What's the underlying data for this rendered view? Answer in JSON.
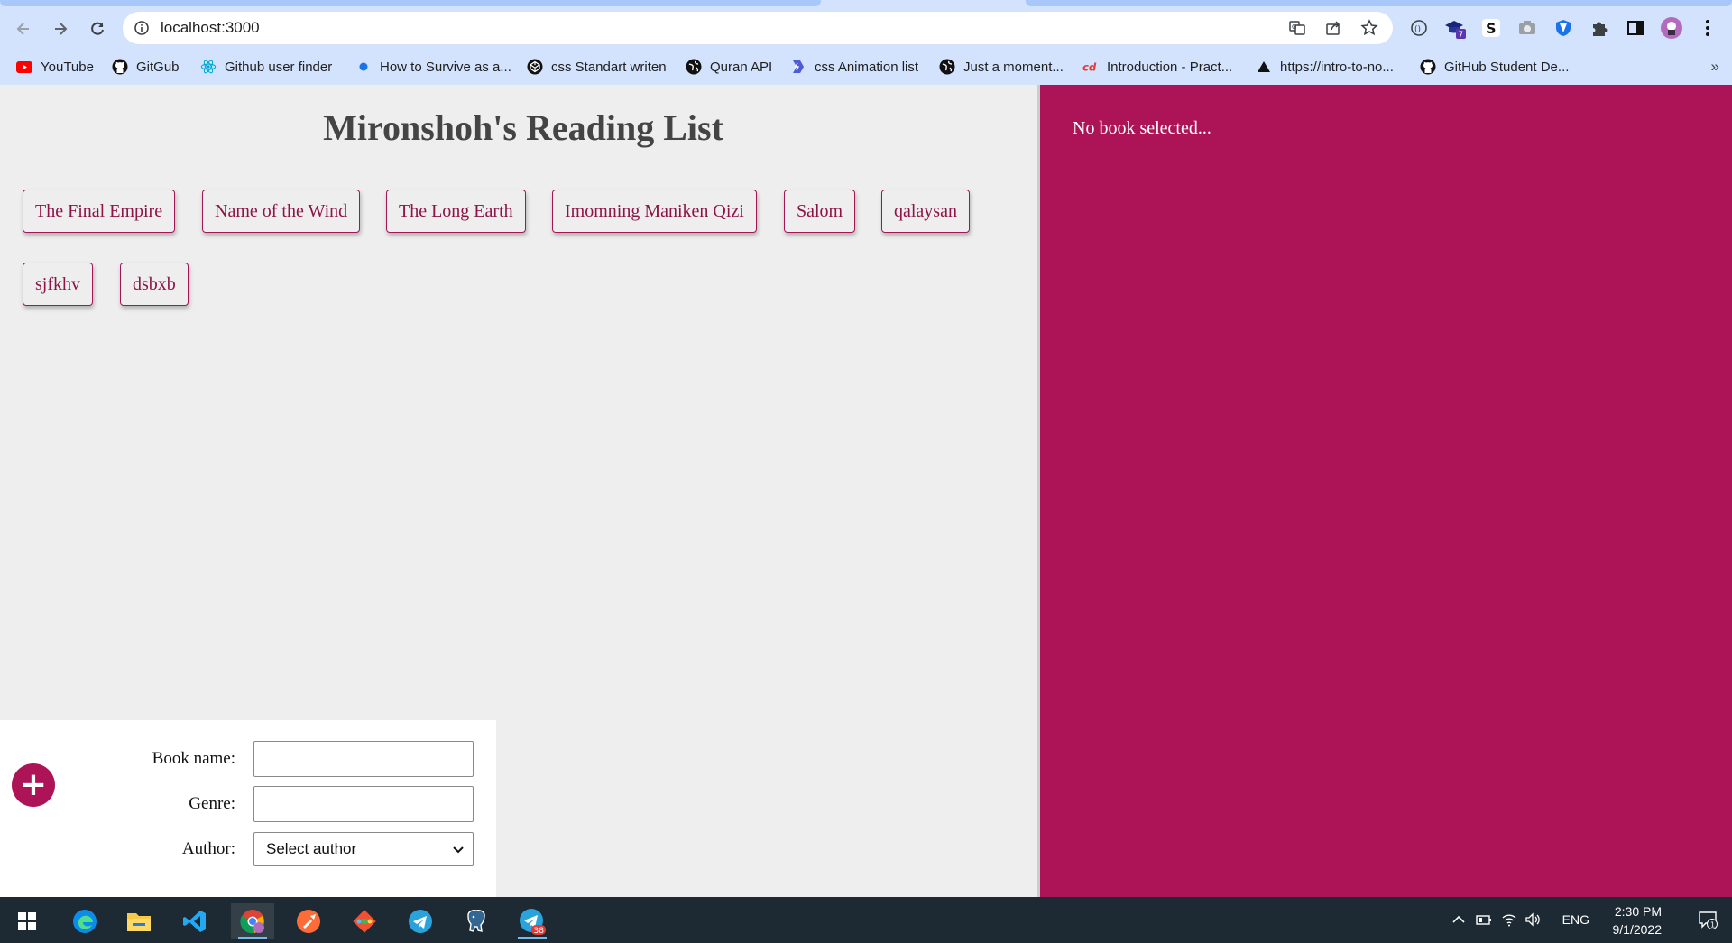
{
  "browser": {
    "url": "localhost:3000",
    "bookmarks": [
      {
        "label": "YouTube",
        "icon": "youtube-icon"
      },
      {
        "label": "GitGub",
        "icon": "github-icon"
      },
      {
        "label": "Github user finder",
        "icon": "react-icon"
      },
      {
        "label": "How to Survive as a...",
        "icon": "dot-icon"
      },
      {
        "label": "css Standart writen",
        "icon": "codepen-icon"
      },
      {
        "label": "Quran API",
        "icon": "globe-icon"
      },
      {
        "label": "css Animation list",
        "icon": "bolt-icon"
      },
      {
        "label": "Just a moment...",
        "icon": "globe-icon"
      },
      {
        "label": "Introduction - Pract...",
        "icon": "logo-icon"
      },
      {
        "label": "https://intro-to-no...",
        "icon": "triangle-icon"
      },
      {
        "label": "GitHub Student De...",
        "icon": "github-icon"
      }
    ],
    "more_label": "»",
    "extension_badge": "7"
  },
  "app": {
    "title": "Mironshoh's Reading List",
    "books": [
      "The Final Empire",
      "Name of the Wind",
      "The Long Earth",
      "Imomning Maniken Qizi",
      "Salom",
      "qalaysan",
      "sjfkhv",
      "dsbxb"
    ],
    "details": "No book selected...",
    "form": {
      "book_name_label": "Book name:",
      "genre_label": "Genre:",
      "author_label": "Author:",
      "book_name_value": "",
      "genre_value": "",
      "author_selected": "Select author"
    },
    "add_button": "+"
  },
  "taskbar": {
    "telegram_badge": "38",
    "language": "ENG",
    "time": "2:30 PM",
    "date": "9/1/2022",
    "notification_count": "1"
  },
  "colors": {
    "accent": "#ad1457",
    "page_bg": "#eeeeee",
    "chrome_bg": "#d3e3fd",
    "taskbar_bg": "#1d2a33"
  }
}
